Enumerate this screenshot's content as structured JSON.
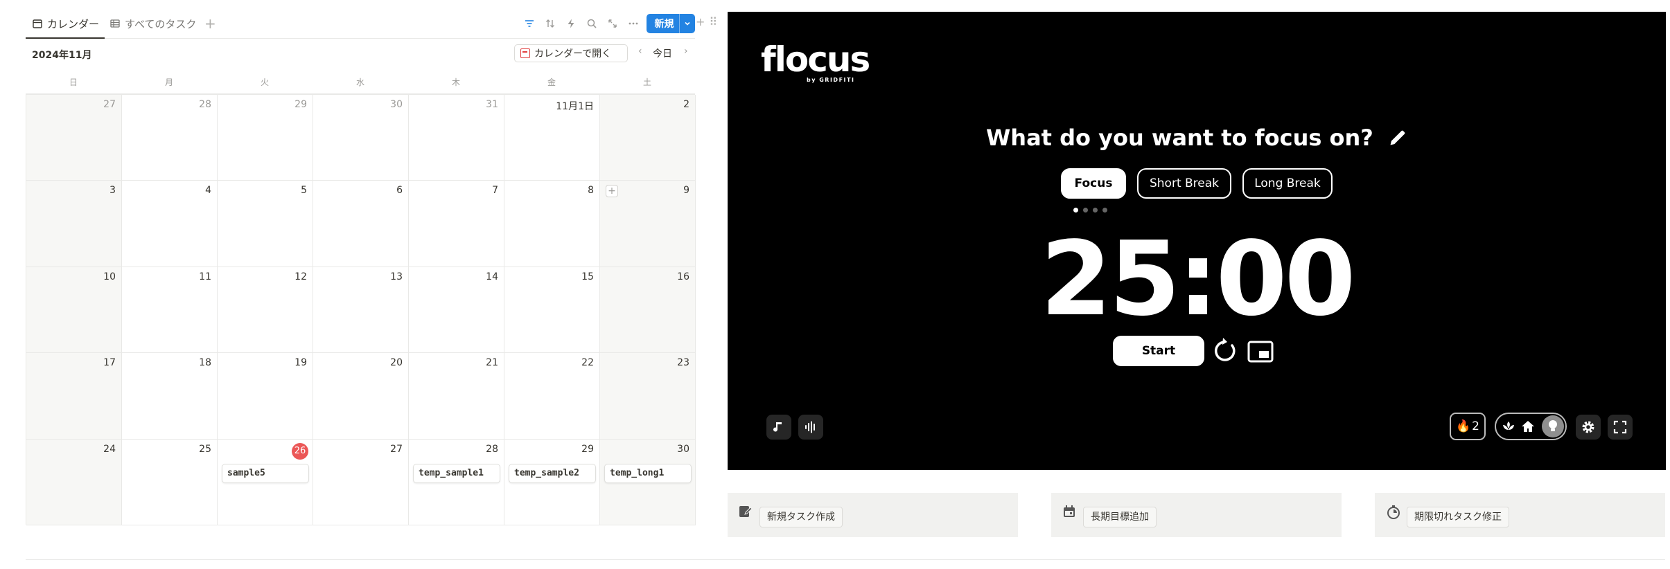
{
  "calendar": {
    "tabs": {
      "calendar": "カレンダー",
      "all_tasks": "すべてのタスク"
    },
    "new_button": "新規",
    "month_title": "2024年11月",
    "open_in_calendar": "カレンダーで開く",
    "today_label": "今日",
    "weekdays": [
      "日",
      "月",
      "火",
      "水",
      "木",
      "金",
      "土"
    ],
    "weeks": [
      [
        "27",
        "28",
        "29",
        "30",
        "31",
        "11月1日",
        "2"
      ],
      [
        "3",
        "4",
        "5",
        "6",
        "7",
        "8",
        "9"
      ],
      [
        "10",
        "11",
        "12",
        "13",
        "14",
        "15",
        "16"
      ],
      [
        "17",
        "18",
        "19",
        "20",
        "21",
        "22",
        "23"
      ],
      [
        "24",
        "25",
        "26",
        "27",
        "28",
        "29",
        "30"
      ]
    ],
    "events": {
      "w4_d2": "sample5",
      "w4_d4": "temp_sample1",
      "w4_d5": "temp_sample2",
      "w4_d6": "temp_long1"
    }
  },
  "flocus": {
    "logo": "flocus",
    "logo_sub": "by GRIDFITI",
    "question": "What do you want to focus on?",
    "modes": [
      "Focus",
      "Short Break",
      "Long Break"
    ],
    "active_mode": "Focus",
    "timer": "25:00",
    "start_label": "Start",
    "streak_count": "2"
  },
  "actions": [
    "新規タスク作成",
    "長期目標追加",
    "期限切れタスク修正"
  ],
  "colors": {
    "accent": "#2383e2",
    "today": "#eb5757",
    "flocus_bg": "#000000"
  }
}
